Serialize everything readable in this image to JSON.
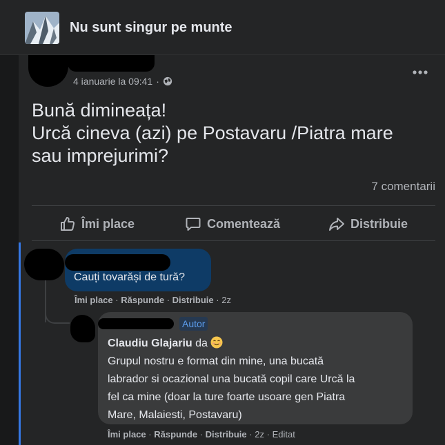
{
  "group": {
    "name": "Nu sunt singur pe munte"
  },
  "post": {
    "date": "4 ianuarie la 09:41",
    "text_lines": [
      "Bună dimineața!",
      "Urcă cineva (azi) pe Postavaru /Piatra mare",
      "sau imprejurimi?"
    ],
    "comments_count": "7 comentarii",
    "actions": {
      "like": "Îmi place",
      "comment": "Comentează",
      "share": "Distribuie"
    }
  },
  "comment1": {
    "text": "Cauți tovarăși de tură?",
    "meta": {
      "like": "Îmi place",
      "reply": "Răspunde",
      "share": "Distribuie",
      "time": "2z",
      "separator": "·"
    }
  },
  "reply1": {
    "badge": "Autor",
    "mention": "Claudiu Glajariu",
    "mention_suffix": "da",
    "body_lines": [
      "Grupul nostru e format din mine, una bucată",
      "labrador si ocazional una bucată copil care Urcă la",
      "fel ca mine (doar la ture foarte usoare gen Piatra",
      "Mare, Malaiesti, Postavaru)"
    ],
    "meta": {
      "like": "Îmi place",
      "reply": "Răspunde",
      "share": "Distribuie",
      "time": "2z",
      "edited": "Editat",
      "separator": "·"
    }
  },
  "colors": {
    "accent": "#3578e5",
    "bubble_self": "#0e3b66",
    "bubble_reply": "#3a3b3c",
    "badge_bg": "#263951",
    "badge_text": "#5c9ded"
  },
  "icons": [
    "globe-icon",
    "more-icon",
    "like-icon",
    "comment-icon",
    "share-icon",
    "smile-emoji-icon"
  ]
}
